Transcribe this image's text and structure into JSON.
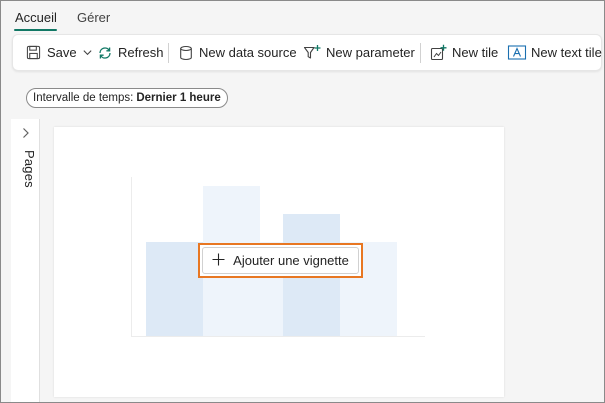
{
  "tabs": [
    {
      "label": "Accueil",
      "active": true
    },
    {
      "label": "Gérer",
      "active": false
    }
  ],
  "toolbar": {
    "save_label": "Save",
    "refresh_label": "Refresh",
    "new_data_source_label": "New data source",
    "new_parameter_label": "New parameter",
    "new_tile_label": "New tile",
    "new_text_tile_label": "New text tile"
  },
  "filter": {
    "label": "Intervalle de temps:",
    "value": "Dernier 1 heure"
  },
  "pages_panel": {
    "label": "Pages"
  },
  "canvas": {
    "add_tile_label": "Ajouter une vignette"
  },
  "colors": {
    "accent": "#117865",
    "highlight": "#e87722",
    "bar_light": "#eef4fb",
    "bar_medium": "#dde9f6"
  }
}
